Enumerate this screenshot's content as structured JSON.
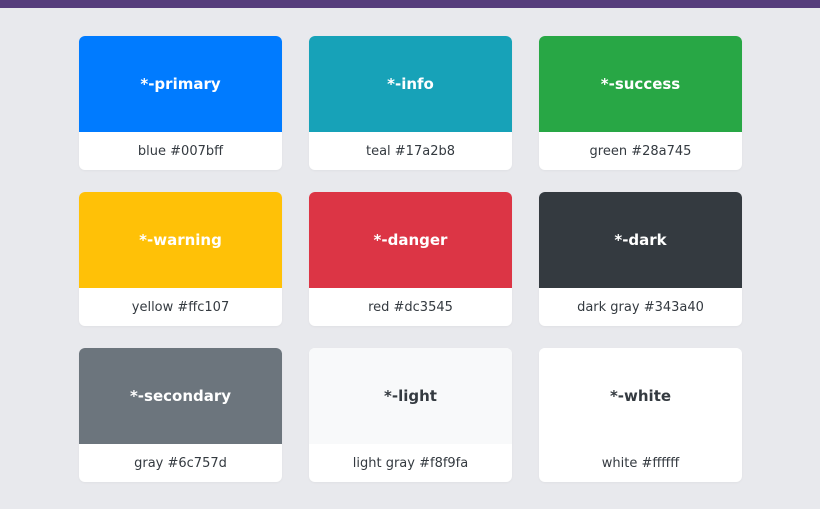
{
  "colors": [
    {
      "name": "*-primary",
      "caption": "blue #007bff",
      "bg": "#007bff",
      "fg": "#ffffff"
    },
    {
      "name": "*-info",
      "caption": "teal #17a2b8",
      "bg": "#17a2b8",
      "fg": "#ffffff"
    },
    {
      "name": "*-success",
      "caption": "green #28a745",
      "bg": "#28a745",
      "fg": "#ffffff"
    },
    {
      "name": "*-warning",
      "caption": "yellow #ffc107",
      "bg": "#ffc107",
      "fg": "#ffffff"
    },
    {
      "name": "*-danger",
      "caption": "red #dc3545",
      "bg": "#dc3545",
      "fg": "#ffffff"
    },
    {
      "name": "*-dark",
      "caption": "dark gray #343a40",
      "bg": "#343a40",
      "fg": "#ffffff"
    },
    {
      "name": "*-secondary",
      "caption": "gray #6c757d",
      "bg": "#6c757d",
      "fg": "#ffffff"
    },
    {
      "name": "*-light",
      "caption": "light gray #f8f9fa",
      "bg": "#f8f9fa",
      "fg": "#343a40"
    },
    {
      "name": "*-white",
      "caption": "white #ffffff",
      "bg": "#ffffff",
      "fg": "#343a40"
    }
  ],
  "theme": {
    "header_color": "#563d7c",
    "page_background": "#e8e9ed"
  }
}
